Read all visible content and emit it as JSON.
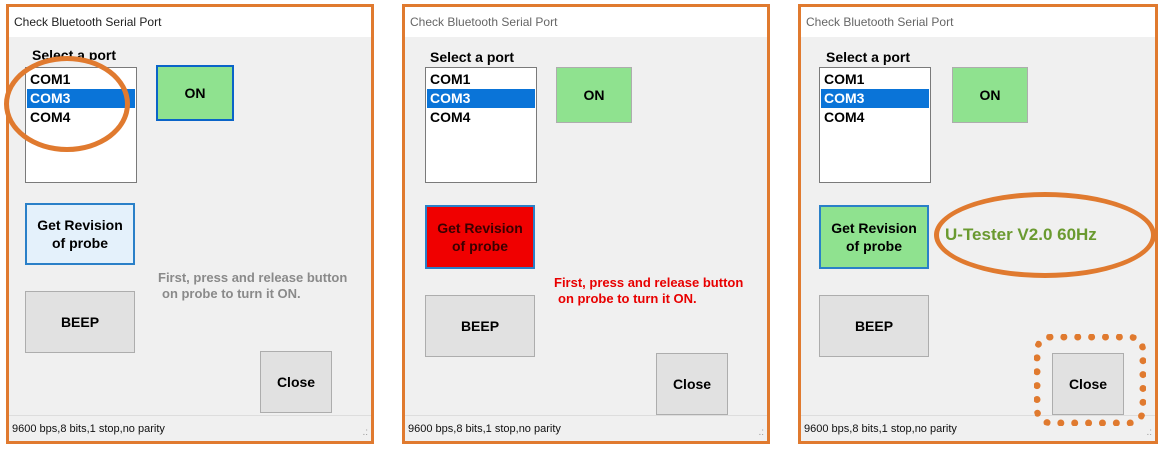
{
  "panels": [
    {
      "title": "Check Bluetooth Serial Port",
      "select_label": "Select a port",
      "ports": [
        "COM1",
        "COM3",
        "COM4"
      ],
      "selected_port": "COM3",
      "on_label": "ON",
      "revision_label": [
        "Get Revision",
        "of probe"
      ],
      "beep_label": "BEEP",
      "close_label": "Close",
      "message": [
        "First, press and release button",
        "on probe to turn it ON."
      ],
      "status": "9600 bps,8 bits,1 stop,no parity"
    },
    {
      "title": "Check Bluetooth Serial Port",
      "select_label": "Select a port",
      "ports": [
        "COM1",
        "COM3",
        "COM4"
      ],
      "selected_port": "COM3",
      "on_label": "ON",
      "revision_label": [
        "Get Revision",
        "of probe"
      ],
      "beep_label": "BEEP",
      "close_label": "Close",
      "message": [
        "First, press and release button",
        "on probe to turn it ON."
      ],
      "status": "9600 bps,8 bits,1 stop,no parity"
    },
    {
      "title": "Check Bluetooth Serial Port",
      "select_label": "Select a port",
      "ports": [
        "COM1",
        "COM3",
        "COM4"
      ],
      "selected_port": "COM3",
      "on_label": "ON",
      "revision_label": [
        "Get Revision",
        "of probe"
      ],
      "beep_label": "BEEP",
      "close_label": "Close",
      "version_text": "U-Tester V2.0 60Hz",
      "status": "9600 bps,8 bits,1 stop,no parity"
    }
  ],
  "colors": {
    "annotation": "#e07a2f",
    "on_button": "#8fe28f",
    "revision_active": "#f00000",
    "selection": "#0a74d8",
    "message_hint": "#8a8a8a",
    "message_alert": "#e80000",
    "version_text": "#6a9a30"
  }
}
